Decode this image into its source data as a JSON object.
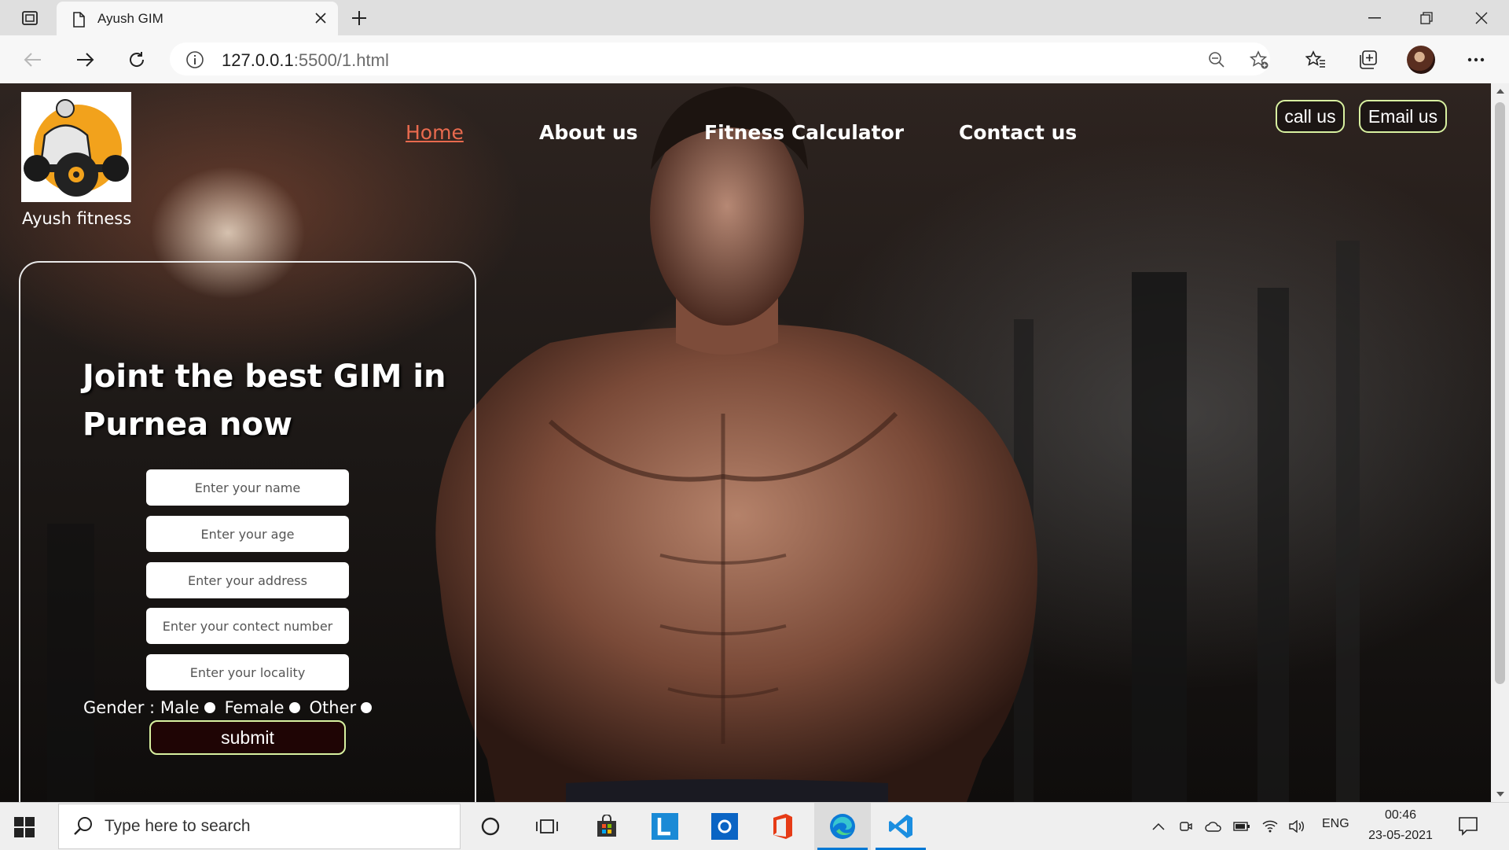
{
  "browser": {
    "tab_title": "Ayush GIM",
    "url_host": "127.0.0.1",
    "url_rest": ":5500/1.html",
    "icons": [
      "tab-actions-icon",
      "page-icon",
      "close-icon",
      "new-tab-icon",
      "minimize-icon",
      "restore-icon",
      "window-close-icon",
      "back-icon",
      "forward-icon",
      "refresh-icon",
      "info-icon",
      "zoom-out-icon",
      "add-favorite-icon",
      "favorites-icon",
      "collections-icon",
      "profile-avatar",
      "more-icon"
    ]
  },
  "site": {
    "brand": "Ayush fitness",
    "nav": [
      {
        "label": "Home",
        "active": true
      },
      {
        "label": "About us",
        "active": false
      },
      {
        "label": "Fitness Calculator",
        "active": false
      },
      {
        "label": "Contact us",
        "active": false
      }
    ],
    "call_label": "call us",
    "email_label": "Email us",
    "headline": "Joint the best GIM in Purnea now",
    "form": {
      "name_placeholder": "Enter your name",
      "age_placeholder": "Enter your age",
      "address_placeholder": "Enter your address",
      "contact_placeholder": "Enter your contect number",
      "locality_placeholder": "Enter your locality",
      "gender_label": "Gender :",
      "options": [
        "Male",
        "Female",
        "Other"
      ],
      "submit_label": "submit"
    },
    "accent_colors": {
      "active_nav": "#e86a4e",
      "pill_border": "#d8f1a0",
      "submit_bg": "#1f0505"
    }
  },
  "taskbar": {
    "search_placeholder": "Type here to search",
    "apps": [
      "cortana-icon",
      "task-view-icon",
      "store-icon",
      "l-app-icon",
      "outlook-icon",
      "office-icon",
      "edge-icon",
      "vscode-icon"
    ],
    "language": "ENG",
    "time": "00:46",
    "date": "23-05-2021"
  }
}
